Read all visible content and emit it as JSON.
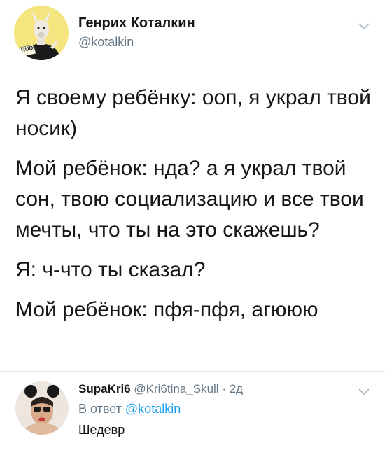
{
  "tweet": {
    "author_name": "Генрих Коталкин",
    "author_handle": "@kotalkin",
    "avatar_badge": "RUDE",
    "paragraphs": [
      "Я своему ребёнку: ооп, я украл твой носик)",
      "Мой ребёнок: нда? а я украл твой сон, твою социализацию и все твои мечты, что ты на это скажешь?",
      "Я: ч-что ты сказал?",
      "Мой ребёнок: пфя-пфя, агююю"
    ]
  },
  "reply": {
    "author_name": "SupaKri6",
    "author_handle": "@Kri6tina_Skull",
    "separator": "·",
    "time": "2д",
    "reply_prefix": "В ответ",
    "reply_mention": "@kotalkin",
    "text": "Шедевр"
  },
  "icons": {
    "tweet_menu": "chevron-down-icon",
    "reply_menu": "chevron-down-icon"
  },
  "colors": {
    "text": "#14171a",
    "secondary": "#657786",
    "link": "#1da1f2",
    "divider": "#e1e8ed"
  }
}
